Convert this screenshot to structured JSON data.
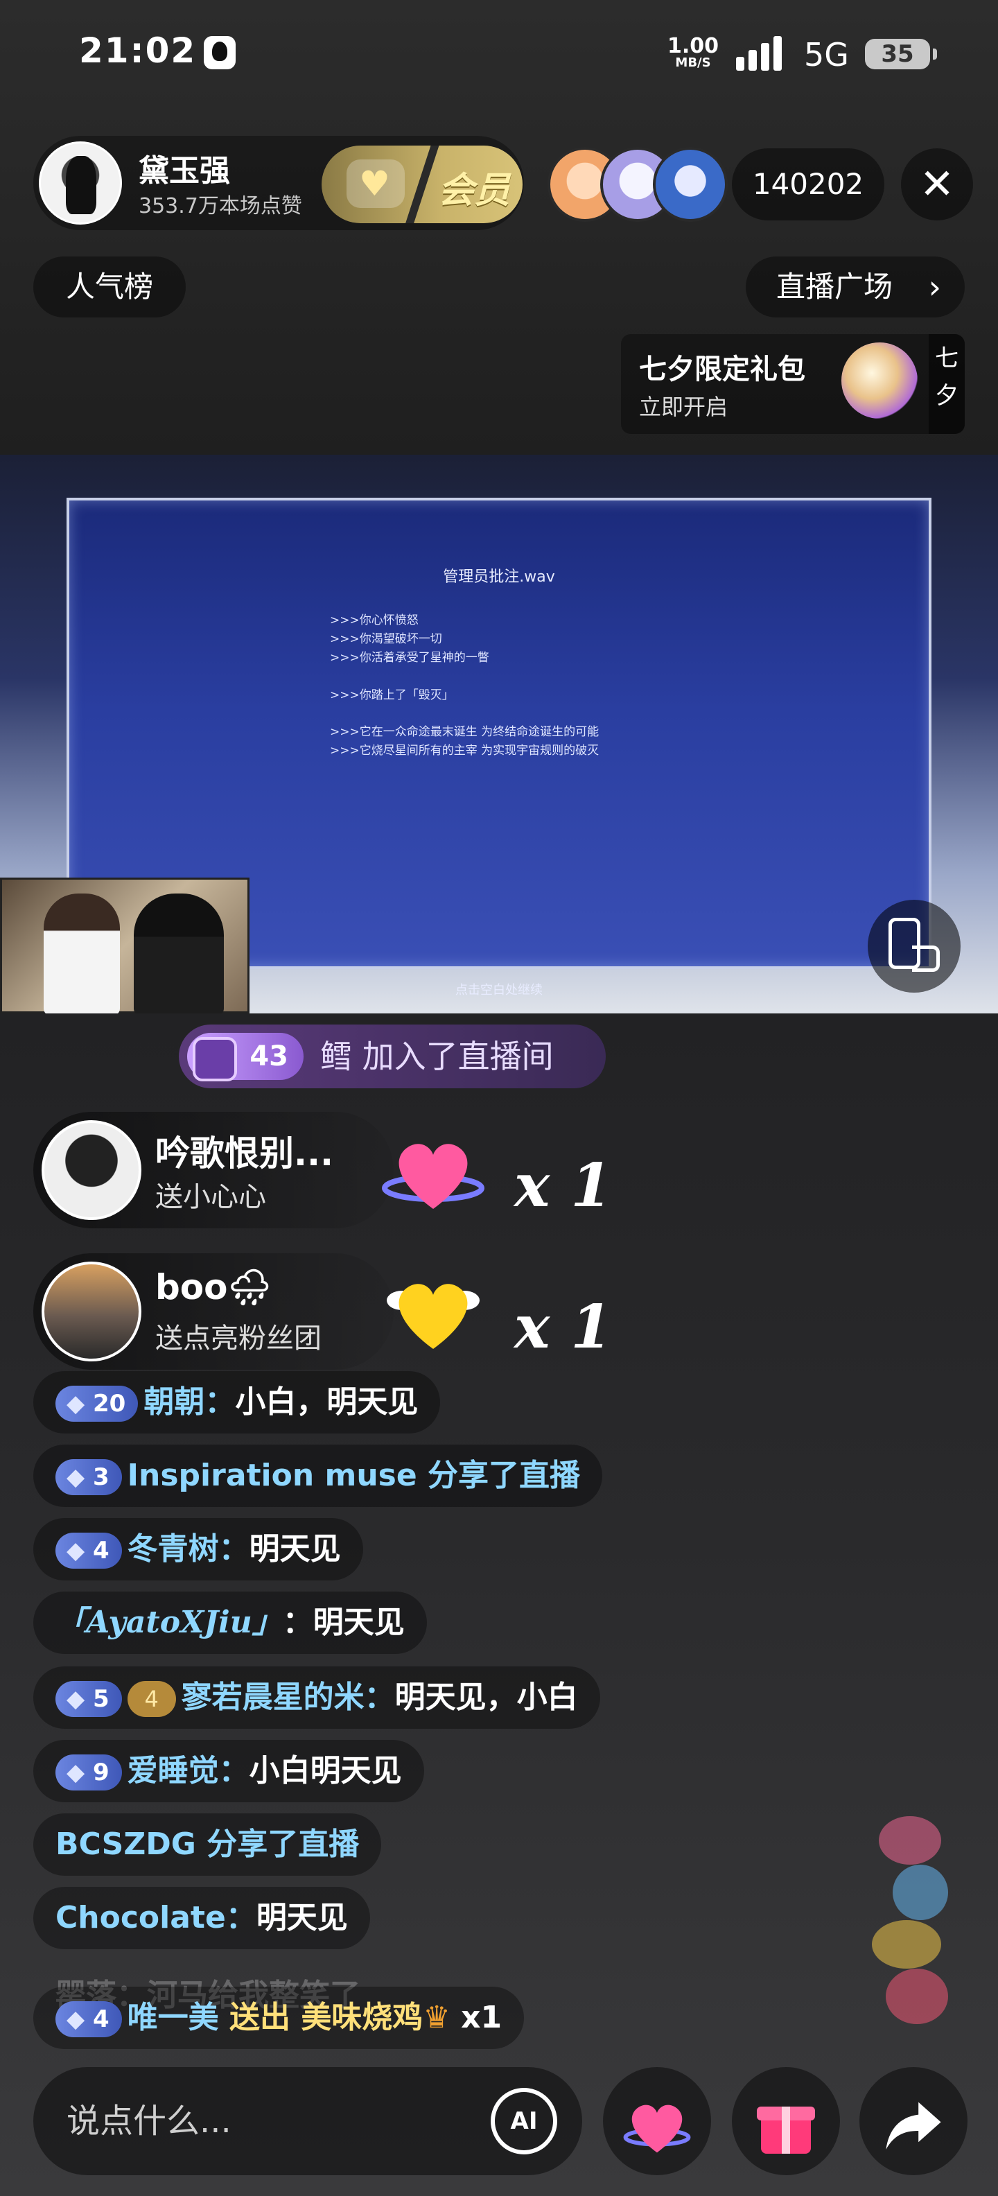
{
  "status_bar": {
    "time": "21:02",
    "net_speed": "1.00",
    "net_unit": "MB/S",
    "network": "5G",
    "battery": "35"
  },
  "header": {
    "anchor_name": "黛玉强",
    "anchor_likes": "353.7万本场点赞",
    "member_label": "会员",
    "viewer_count": "140202",
    "close_icon": "close-icon",
    "rank_label": "人气榜",
    "square_label": "直播广场",
    "square_chevron": "›"
  },
  "promo": {
    "title": "七夕限定礼包",
    "subtitle": "立即开启",
    "side_1": "七",
    "side_2": "夕"
  },
  "video": {
    "title": "管理员批注.wav",
    "lines_a": [
      ">>>你心怀愤怒",
      ">>>你渴望破坏一切",
      ">>>你活着承受了星神的一瞥"
    ],
    "lines_b": [
      ">>>你踏上了「毁灭」"
    ],
    "lines_c": [
      ">>>它在一众命途最末诞生 为终结命途诞生的可能",
      ">>>它烧尽星间所有的主宰 为实现宇宙规则的破灭"
    ],
    "hint": "点击空白处继续"
  },
  "join_banner": {
    "level": "43",
    "text": "鳕 加入了直播间"
  },
  "gift_streaks": [
    {
      "name": "吟歌恨别...",
      "action": "送小心心",
      "count": "x 1",
      "gift_color": "#ff5aa0"
    },
    {
      "name": "boo🌧",
      "action": "送点亮粉丝团",
      "count": "x 1",
      "gift_color": "#ffd21f"
    }
  ],
  "chat": {
    "m1": {
      "level": "20",
      "nick": "朝朝：",
      "msg": "小白，明天见"
    },
    "m2": {
      "level": "3",
      "text": "Inspiration muse 分享了直播"
    },
    "m3": {
      "level": "4",
      "nick": "冬青树：",
      "msg": "明天见"
    },
    "m4": {
      "nick": "「AyatoXJiu」",
      "msg": "：明天见"
    },
    "m5": {
      "level": "5",
      "fan_level": "4",
      "nick": "寥若晨星的米：",
      "msg": "明天见，小白"
    },
    "m6": {
      "level": "9",
      "nick": "爱睡觉：",
      "msg": "小白明天见"
    },
    "m7": {
      "text": "BCSZDG 分享了直播"
    },
    "m8": {
      "nick": "Chocolate：",
      "msg": "明天见"
    },
    "ghost": "罂落：河马给我整笑了",
    "m9": {
      "level": "4",
      "nick": "唯一美",
      "action": " 送出 ",
      "gift": "美味烧鸡",
      "count": " x1"
    }
  },
  "bottom_bar": {
    "input_placeholder": "说点什么...",
    "ai_label": "AI"
  }
}
